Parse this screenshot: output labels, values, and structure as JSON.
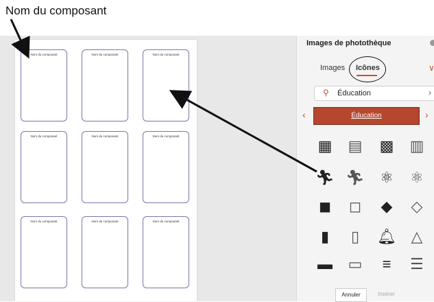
{
  "caption": "Nom du composant",
  "cards": [
    {
      "label": "Nom du composant"
    },
    {
      "label": "Nom du composant"
    },
    {
      "label": "Nom du composant"
    },
    {
      "label": "Nom du composant"
    },
    {
      "label": "Nom du composant"
    },
    {
      "label": "Nom du composant"
    },
    {
      "label": "Nom du composant"
    },
    {
      "label": "Nom du composant"
    },
    {
      "label": "Nom du composant"
    }
  ],
  "panel": {
    "title": "Images de photothèque",
    "tabs": [
      "Images",
      "Icônes"
    ],
    "search_value": "Éducation",
    "category": "Éducation",
    "icons": [
      "abacus-filled-icon",
      "abacus-outline-icon",
      "abacus-dark-icon",
      "abacus-light-icon",
      "athlete-filled-icon",
      "athlete-outline-icon",
      "atom-filled-icon",
      "atom-outline-icon",
      "backpack-filled-icon",
      "backpack-outline-icon",
      "shapes-filled-icon",
      "shapes-outline-icon",
      "beaker-filled-icon",
      "beaker-outline-icon",
      "bell-filled-icon",
      "bell-outline-icon",
      "blackboard-filled-icon",
      "blackboard-outline-icon",
      "books-filled-icon",
      "books-outline-icon"
    ],
    "cancel": "Annuler",
    "insert": "Insérer"
  },
  "colors": {
    "accent": "#b5472f",
    "card_border": "#7777aa"
  }
}
